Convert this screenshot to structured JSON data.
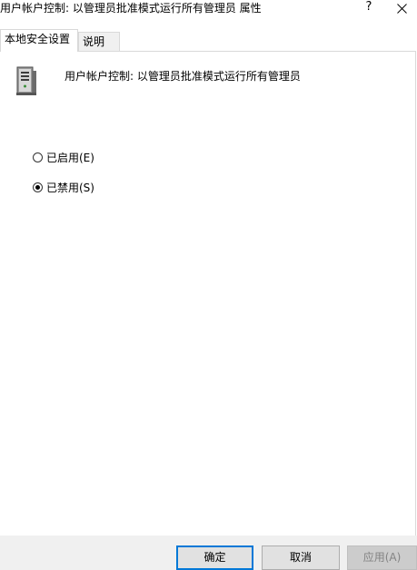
{
  "window": {
    "title": "用户帐户控制: 以管理员批准模式运行所有管理员 属性",
    "help_label": "?",
    "close_icon": "close-icon"
  },
  "tabs": [
    {
      "label": "本地安全设置",
      "active": true
    },
    {
      "label": "说明",
      "active": false
    }
  ],
  "policy": {
    "icon": "computer-tower-icon",
    "name": "用户帐户控制: 以管理员批准模式运行所有管理员"
  },
  "options": [
    {
      "label": "已启用(E)",
      "selected": false
    },
    {
      "label": "已禁用(S)",
      "selected": true
    }
  ],
  "buttons": {
    "ok": "确定",
    "cancel": "取消",
    "apply": "应用(A)"
  },
  "colors": {
    "accent": "#0078d7",
    "footer_bg": "#f0f0f0",
    "disabled_text": "#838383"
  }
}
